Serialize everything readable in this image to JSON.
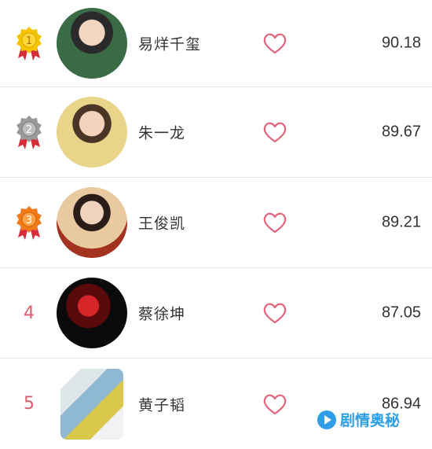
{
  "ranking": {
    "items": [
      {
        "rank": "1",
        "name": "易烊千玺",
        "score": "90.18",
        "badge": "gold-medal"
      },
      {
        "rank": "2",
        "name": "朱一龙",
        "score": "89.67",
        "badge": "silver-medal"
      },
      {
        "rank": "3",
        "name": "王俊凯",
        "score": "89.21",
        "badge": "bronze-medal"
      },
      {
        "rank": "4",
        "name": "蔡徐坤",
        "score": "87.05",
        "badge": "none"
      },
      {
        "rank": "5",
        "name": "黄子韬",
        "score": "86.94",
        "badge": "none"
      }
    ]
  },
  "colors": {
    "heart": "#e36479",
    "rank_number": "#e05a6c",
    "gold": "#f5c400",
    "silver": "#9a9a9a",
    "bronze": "#f07a1a",
    "ribbon": "#d62d3a",
    "watermark": "#2e9ee8"
  },
  "icons": {
    "like": "heart-outline-icon",
    "watermark_logo": "play-logo-icon"
  },
  "watermark": {
    "text": "剧情奥秘"
  }
}
